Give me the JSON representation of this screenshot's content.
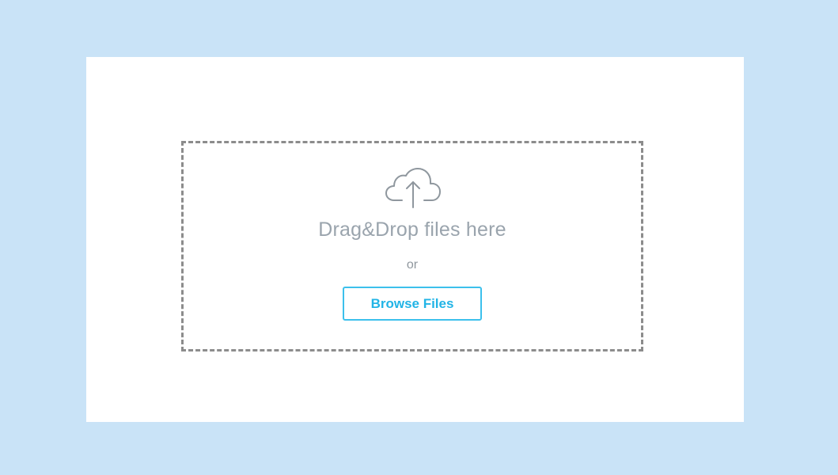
{
  "upload": {
    "icon": "cloud-upload-icon",
    "drop_text": "Drag&Drop files here",
    "or_text": "or",
    "browse_label": "Browse Files"
  },
  "colors": {
    "page_background": "#c9e3f7",
    "card_background": "#ffffff",
    "dashed_border": "#8c8c8c",
    "text_muted": "#9aa4ad",
    "accent": "#22b4e6"
  }
}
